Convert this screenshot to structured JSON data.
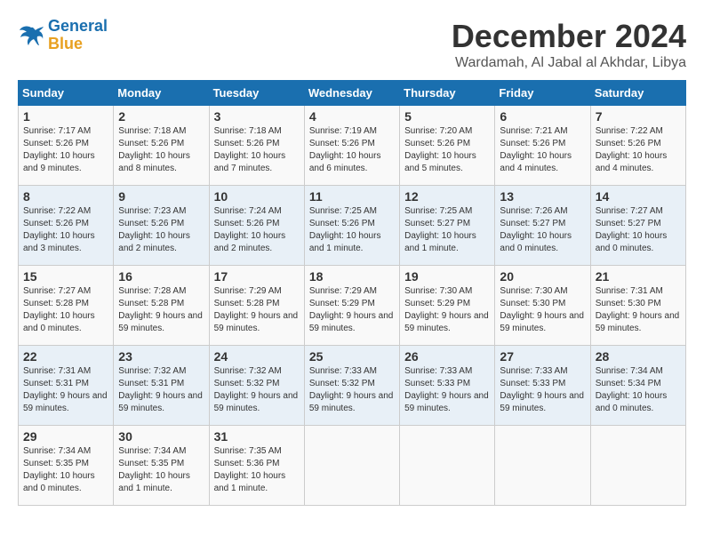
{
  "header": {
    "logo_line1": "General",
    "logo_line2": "Blue",
    "month": "December 2024",
    "location": "Wardamah, Al Jabal al Akhdar, Libya"
  },
  "days_of_week": [
    "Sunday",
    "Monday",
    "Tuesday",
    "Wednesday",
    "Thursday",
    "Friday",
    "Saturday"
  ],
  "weeks": [
    [
      {
        "day": "1",
        "sunrise": "7:17 AM",
        "sunset": "5:26 PM",
        "daylight": "10 hours and 9 minutes."
      },
      {
        "day": "2",
        "sunrise": "7:18 AM",
        "sunset": "5:26 PM",
        "daylight": "10 hours and 8 minutes."
      },
      {
        "day": "3",
        "sunrise": "7:18 AM",
        "sunset": "5:26 PM",
        "daylight": "10 hours and 7 minutes."
      },
      {
        "day": "4",
        "sunrise": "7:19 AM",
        "sunset": "5:26 PM",
        "daylight": "10 hours and 6 minutes."
      },
      {
        "day": "5",
        "sunrise": "7:20 AM",
        "sunset": "5:26 PM",
        "daylight": "10 hours and 5 minutes."
      },
      {
        "day": "6",
        "sunrise": "7:21 AM",
        "sunset": "5:26 PM",
        "daylight": "10 hours and 4 minutes."
      },
      {
        "day": "7",
        "sunrise": "7:22 AM",
        "sunset": "5:26 PM",
        "daylight": "10 hours and 4 minutes."
      }
    ],
    [
      {
        "day": "8",
        "sunrise": "7:22 AM",
        "sunset": "5:26 PM",
        "daylight": "10 hours and 3 minutes."
      },
      {
        "day": "9",
        "sunrise": "7:23 AM",
        "sunset": "5:26 PM",
        "daylight": "10 hours and 2 minutes."
      },
      {
        "day": "10",
        "sunrise": "7:24 AM",
        "sunset": "5:26 PM",
        "daylight": "10 hours and 2 minutes."
      },
      {
        "day": "11",
        "sunrise": "7:25 AM",
        "sunset": "5:26 PM",
        "daylight": "10 hours and 1 minute."
      },
      {
        "day": "12",
        "sunrise": "7:25 AM",
        "sunset": "5:27 PM",
        "daylight": "10 hours and 1 minute."
      },
      {
        "day": "13",
        "sunrise": "7:26 AM",
        "sunset": "5:27 PM",
        "daylight": "10 hours and 0 minutes."
      },
      {
        "day": "14",
        "sunrise": "7:27 AM",
        "sunset": "5:27 PM",
        "daylight": "10 hours and 0 minutes."
      }
    ],
    [
      {
        "day": "15",
        "sunrise": "7:27 AM",
        "sunset": "5:28 PM",
        "daylight": "10 hours and 0 minutes."
      },
      {
        "day": "16",
        "sunrise": "7:28 AM",
        "sunset": "5:28 PM",
        "daylight": "9 hours and 59 minutes."
      },
      {
        "day": "17",
        "sunrise": "7:29 AM",
        "sunset": "5:28 PM",
        "daylight": "9 hours and 59 minutes."
      },
      {
        "day": "18",
        "sunrise": "7:29 AM",
        "sunset": "5:29 PM",
        "daylight": "9 hours and 59 minutes."
      },
      {
        "day": "19",
        "sunrise": "7:30 AM",
        "sunset": "5:29 PM",
        "daylight": "9 hours and 59 minutes."
      },
      {
        "day": "20",
        "sunrise": "7:30 AM",
        "sunset": "5:30 PM",
        "daylight": "9 hours and 59 minutes."
      },
      {
        "day": "21",
        "sunrise": "7:31 AM",
        "sunset": "5:30 PM",
        "daylight": "9 hours and 59 minutes."
      }
    ],
    [
      {
        "day": "22",
        "sunrise": "7:31 AM",
        "sunset": "5:31 PM",
        "daylight": "9 hours and 59 minutes."
      },
      {
        "day": "23",
        "sunrise": "7:32 AM",
        "sunset": "5:31 PM",
        "daylight": "9 hours and 59 minutes."
      },
      {
        "day": "24",
        "sunrise": "7:32 AM",
        "sunset": "5:32 PM",
        "daylight": "9 hours and 59 minutes."
      },
      {
        "day": "25",
        "sunrise": "7:33 AM",
        "sunset": "5:32 PM",
        "daylight": "9 hours and 59 minutes."
      },
      {
        "day": "26",
        "sunrise": "7:33 AM",
        "sunset": "5:33 PM",
        "daylight": "9 hours and 59 minutes."
      },
      {
        "day": "27",
        "sunrise": "7:33 AM",
        "sunset": "5:33 PM",
        "daylight": "9 hours and 59 minutes."
      },
      {
        "day": "28",
        "sunrise": "7:34 AM",
        "sunset": "5:34 PM",
        "daylight": "10 hours and 0 minutes."
      }
    ],
    [
      {
        "day": "29",
        "sunrise": "7:34 AM",
        "sunset": "5:35 PM",
        "daylight": "10 hours and 0 minutes."
      },
      {
        "day": "30",
        "sunrise": "7:34 AM",
        "sunset": "5:35 PM",
        "daylight": "10 hours and 1 minute."
      },
      {
        "day": "31",
        "sunrise": "7:35 AM",
        "sunset": "5:36 PM",
        "daylight": "10 hours and 1 minute."
      },
      null,
      null,
      null,
      null
    ]
  ]
}
